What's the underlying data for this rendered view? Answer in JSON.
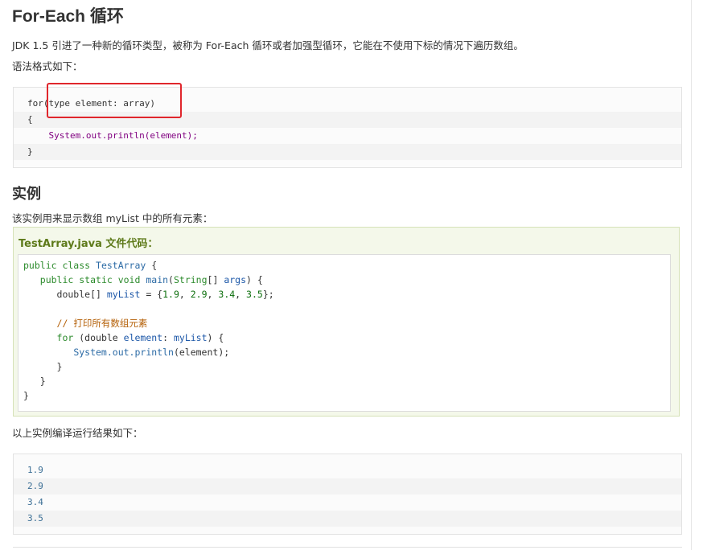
{
  "heading": "For-Each 循环",
  "intro": "JDK 1.5 引进了一种新的循环类型，被称为 For-Each 循环或者加强型循环，它能在不使用下标的情况下遍历数组。",
  "syntax_label": "语法格式如下：",
  "syntax_code": [
    "for(type element: array)",
    "{",
    "    System.out.println(element);",
    "}"
  ],
  "example_heading": "实例",
  "example_desc": "该实例用来显示数组 myList 中的所有元素：",
  "example_title": "TestArray.java 文件代码：",
  "example_code": [
    "public class TestArray {",
    "   public static void main(String[] args) {",
    "      double[] myList = {1.9, 2.9, 3.4, 3.5};",
    "",
    "      // 打印所有数组元素",
    "      for (double element: myList) {",
    "         System.out.println(element);",
    "      }",
    "   }",
    "}"
  ],
  "result_label": "以上实例编译运行结果如下：",
  "output_lines": [
    "1.9",
    "2.9",
    "3.4",
    "3.5"
  ],
  "colors": {
    "highlight_border": "#e0262c",
    "example_title": "#5e7a1a",
    "example_bg": "#f4f8ea"
  }
}
